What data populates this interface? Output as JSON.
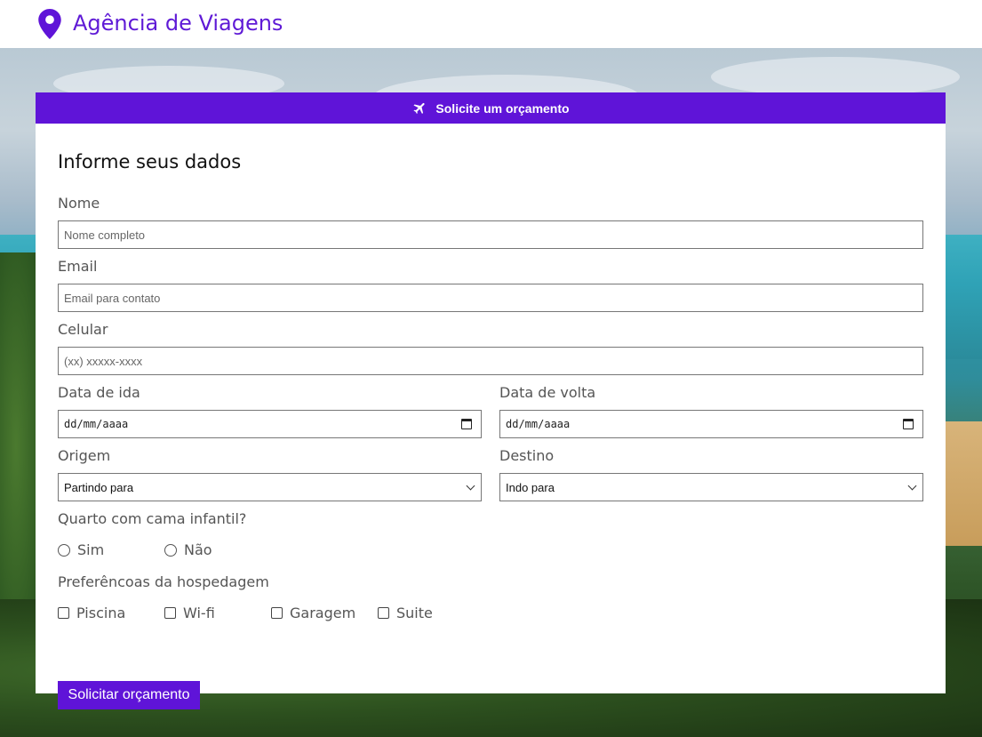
{
  "brand": {
    "title": "Agência de Viagens",
    "icon": "map-pin-icon"
  },
  "card": {
    "header": "Solicite um orçamento",
    "header_icon": "airplane-icon"
  },
  "form": {
    "heading": "Informe seus dados",
    "name": {
      "label": "Nome",
      "placeholder": "Nome completo"
    },
    "email": {
      "label": "Email",
      "placeholder": "Email para contato"
    },
    "phone": {
      "label": "Celular",
      "placeholder": "(xx) xxxxx-xxxx"
    },
    "date_out": {
      "label": "Data de ida",
      "value": "dd/mm/aaaa"
    },
    "date_back": {
      "label": "Data de volta",
      "value": "dd/mm/aaaa"
    },
    "origin": {
      "label": "Origem",
      "value": "Partindo para"
    },
    "destination": {
      "label": "Destino",
      "value": "Indo para"
    },
    "child_bed": {
      "label": "Quarto com cama infantil?",
      "options": [
        "Sim",
        "Não"
      ]
    },
    "preferences": {
      "label": "Preferêncoas da hospedagem",
      "options": [
        "Piscina",
        "Wi-fi",
        "Garagem",
        "Suite"
      ]
    },
    "submit": "Solicitar orçamento"
  },
  "colors": {
    "accent": "#5f14d8",
    "brand_text": "#5f1ad6"
  }
}
